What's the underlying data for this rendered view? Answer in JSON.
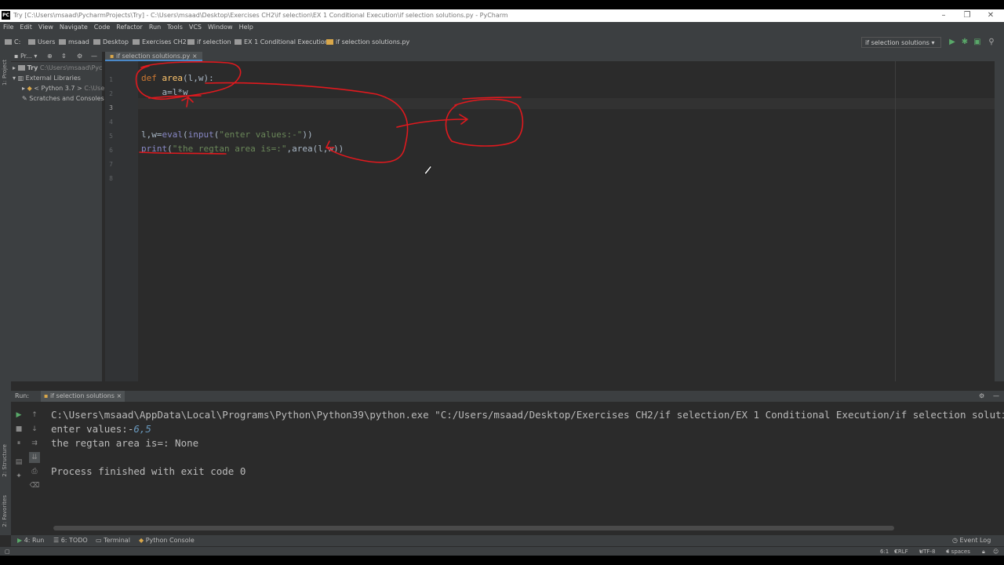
{
  "window": {
    "title": "Try [C:\\Users\\msaad\\PycharmProjects\\Try] - C:\\Users\\msaad\\Desktop\\Exercises CH2\\if selection\\EX 1 Conditional Execution\\if selection solutions.py - PyCharm",
    "app_icon": "PC"
  },
  "menu": [
    "File",
    "Edit",
    "View",
    "Navigate",
    "Code",
    "Refactor",
    "Run",
    "Tools",
    "VCS",
    "Window",
    "Help"
  ],
  "breadcrumbs": [
    "C:",
    "Users",
    "msaad",
    "Desktop",
    "Exercises CH2",
    "if selection",
    "EX 1 Conditional Execution",
    "if selection solutions.py"
  ],
  "run_config": "if selection solutions",
  "project": {
    "tab_label": "Pr...",
    "items": [
      {
        "label": "Try",
        "path": "C:\\Users\\msaad\\Pyc"
      },
      {
        "label": "External Libraries"
      },
      {
        "label": "< Python 3.7 >",
        "path": "C:\\Use"
      },
      {
        "label": "Scratches and Consoles"
      }
    ]
  },
  "left_strip": {
    "project": "1: Project",
    "structure": "2: Structure",
    "favorites": "2: Favorites"
  },
  "editor": {
    "tab": "if selection solutions.py",
    "line_numbers": [
      "1",
      "2",
      "3",
      "4",
      "5",
      "6",
      "7",
      "8"
    ]
  },
  "run": {
    "label": "Run:",
    "tab": "if selection solutions",
    "console": {
      "cmd": "C:\\Users\\msaad\\AppData\\Local\\Programs\\Python\\Python39\\python.exe \"C:/Users/msaad/Desktop/Exercises CH2/if selection/EX 1 Conditional Execution/if selection solutions.py\"",
      "prompt": "enter values:-",
      "input": "6,5",
      "output": "the regtan area is=: None",
      "exit": "Process finished with exit code 0"
    }
  },
  "bottom_tabs": {
    "run": "4: Run",
    "todo": "6: TODO",
    "terminal": "Terminal",
    "python_console": "Python Console",
    "event_log": "Event Log"
  },
  "status": {
    "position": "6:1",
    "line_sep": "CRLF",
    "encoding": "UTF-8",
    "indent": "4 spaces"
  },
  "colors": {
    "annotation": "#e0191e",
    "keyword": "#cc7832",
    "function": "#ffc66d",
    "string": "#6a8759",
    "builtin": "#8888c6"
  }
}
